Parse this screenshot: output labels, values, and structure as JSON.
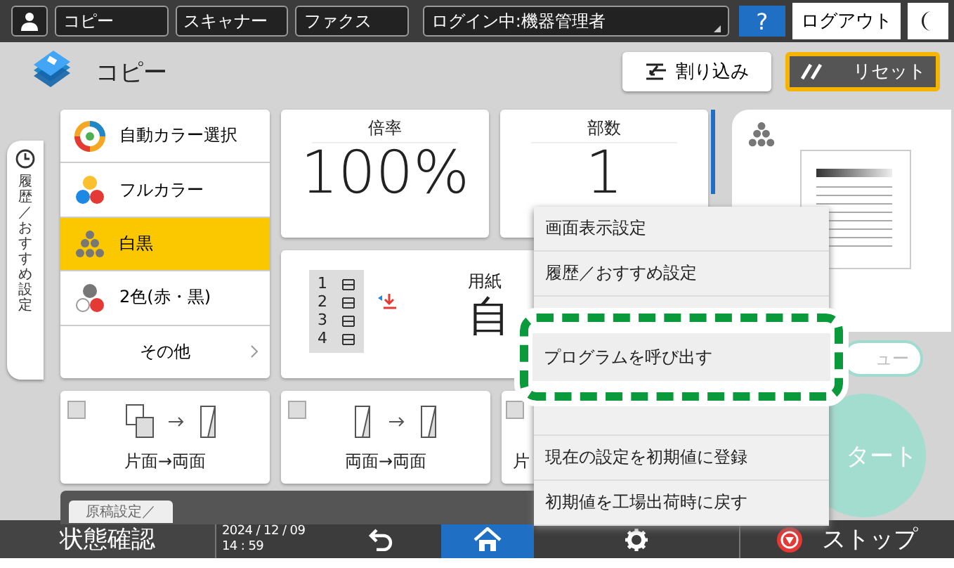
{
  "top_bar": {
    "tabs": [
      {
        "label": "コピー"
      },
      {
        "label": "スキャナー"
      },
      {
        "label": "ファクス"
      }
    ],
    "login": "ログイン中:機器管理者",
    "help": "?",
    "logout": "ログアウト"
  },
  "header": {
    "title": "コピー",
    "buttons": [
      {
        "label": "割り込み",
        "kind": "interrupt"
      },
      {
        "label": "リセット",
        "kind": "reset"
      }
    ]
  },
  "side_tab": "履歴／おすすめ設定",
  "color_modes": [
    {
      "label": "自動カラー選択",
      "kind": "auto",
      "selected": false
    },
    {
      "label": "フルカラー",
      "kind": "full",
      "selected": false
    },
    {
      "label": "白黒",
      "kind": "mono",
      "selected": true
    },
    {
      "label": "2色(赤・黒)",
      "kind": "two",
      "selected": false
    },
    {
      "label": "その他",
      "kind": "more",
      "selected": false
    }
  ],
  "ratio": {
    "label": "倍率",
    "value": "100%"
  },
  "copies": {
    "label": "部数",
    "value": "1"
  },
  "paper": {
    "trays": [
      "1",
      "2",
      "3",
      "4"
    ],
    "label": "用紙",
    "value": "自"
  },
  "duplex": [
    {
      "label": "片面→両面",
      "checked": false,
      "kind": "one_to_two"
    },
    {
      "label": "両面→両面",
      "checked": false,
      "kind": "two_to_two"
    },
    {
      "label": "片",
      "checked": false,
      "kind": "partial"
    }
  ],
  "settings_tab": "原稿設定／",
  "preview_button": "ュー",
  "start_button": "タート",
  "menu": {
    "items": [
      {
        "label": "画面表示設定",
        "highlighted": false
      },
      {
        "label": "履歴／おすすめ設定",
        "highlighted": false
      },
      {
        "label": "プログラムを呼び出す",
        "highlighted": true
      },
      {
        "label": "現在の設定を初期値に登録",
        "highlighted": false
      },
      {
        "label": "初期値を工場出荷時に戻す",
        "highlighted": false
      }
    ]
  },
  "bottom_bar": {
    "status": "状態確認",
    "date": "2024 / 12 / 09",
    "time": "14 : 59",
    "stop": "ストップ"
  }
}
